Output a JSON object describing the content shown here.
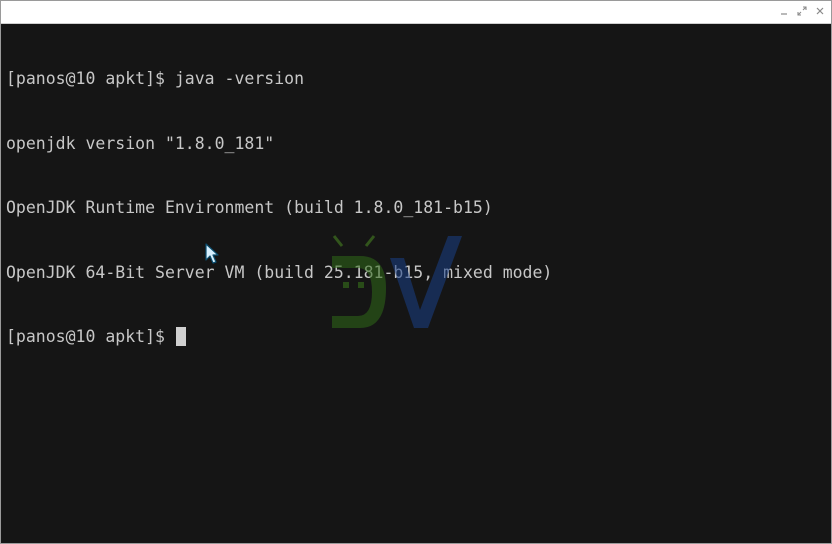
{
  "window": {
    "controls": [
      "minimize-icon",
      "maximize-icon",
      "close-icon"
    ]
  },
  "terminal": {
    "lines": [
      "[panos@10 apkt]$ java -version",
      "openjdk version \"1.8.0_181\"",
      "OpenJDK Runtime Environment (build 1.8.0_181-b15)",
      "OpenJDK 64-Bit Server VM (build 25.181-b15, mixed mode)",
      "[panos@10 apkt]$ "
    ]
  },
  "colors": {
    "background": "#151515",
    "text": "#c7c7c7",
    "titlebar": "#ffffff",
    "watermark_green": "#3d7a1f",
    "watermark_blue": "#1d4a9a"
  }
}
